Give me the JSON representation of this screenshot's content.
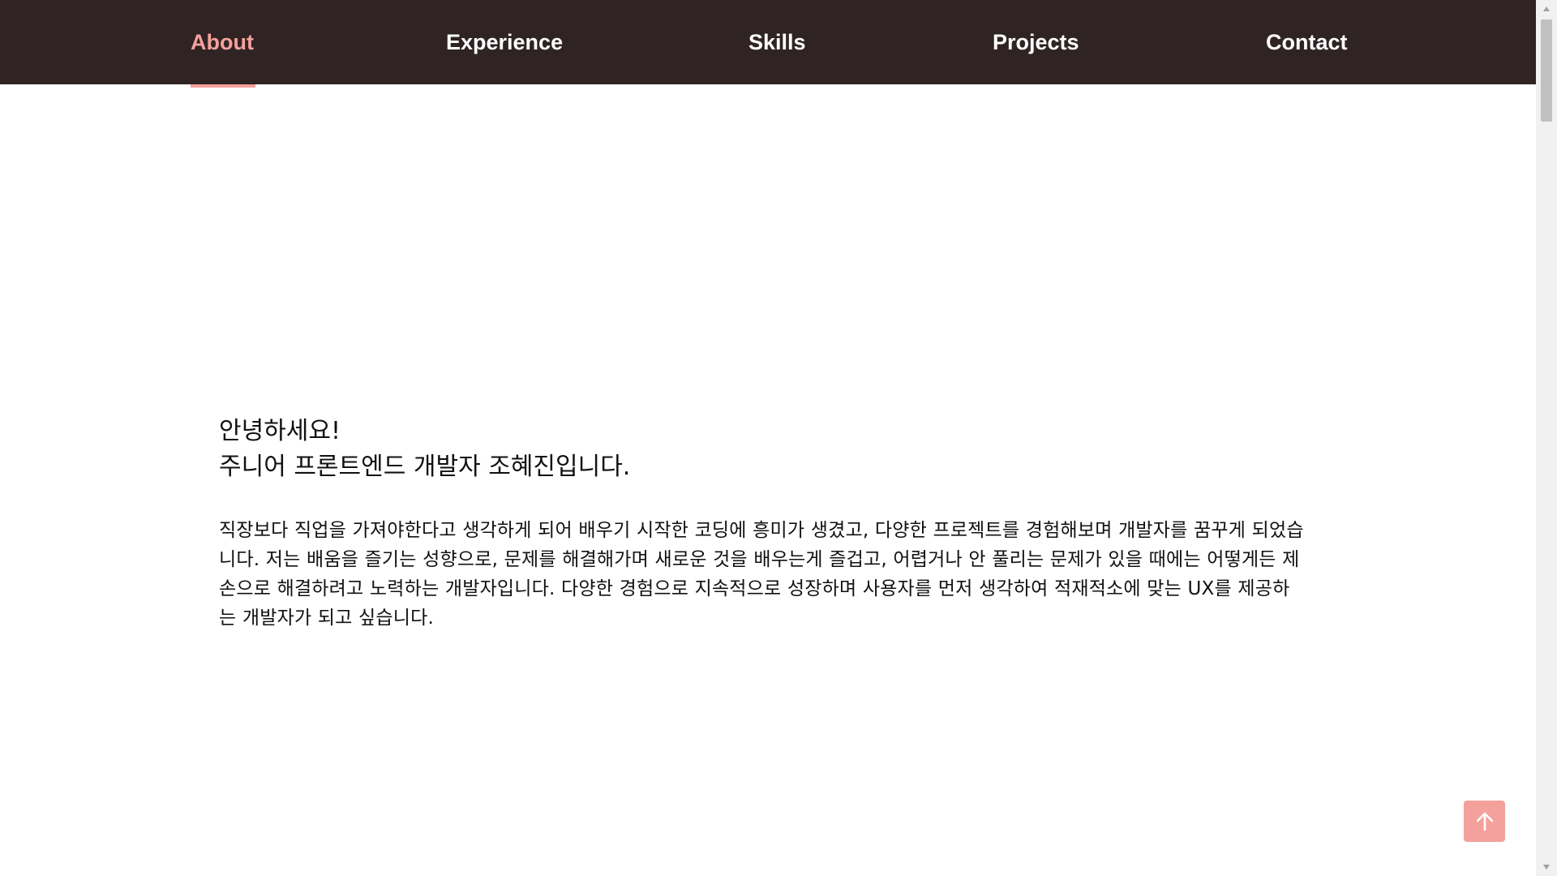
{
  "nav": {
    "items": [
      {
        "label": "About",
        "active": true
      },
      {
        "label": "Experience",
        "active": false
      },
      {
        "label": "Skills",
        "active": false
      },
      {
        "label": "Projects",
        "active": false
      },
      {
        "label": "Contact",
        "active": false
      }
    ]
  },
  "about": {
    "greeting_line1": "안녕하세요!",
    "greeting_line2": "주니어 프론트엔드 개발자 조혜진입니다.",
    "intro": "직장보다 직업을 가져야한다고 생각하게 되어 배우기 시작한 코딩에 흥미가 생겼고, 다양한 프로젝트를 경험해보며 개발자를 꿈꾸게 되었습니다. 저는 배움을 즐기는 성향으로, 문제를 해결해가며 새로운 것을 배우는게 즐겁고, 어렵거나 안 풀리는 문제가 있을 때에는 어떻게든 제 손으로 해결하려고 노력하는 개발자입니다. 다양한 경험으로 지속적으로 성장하며 사용자를 먼저 생각하여 적재적소에 맞는 UX를 제공하는 개발자가 되고 싶습니다."
  },
  "scroll_top": {
    "icon": "arrow-up-icon"
  },
  "colors": {
    "navbar_bg": "#302324",
    "accent": "#f4a19c",
    "nav_text": "#ffffff",
    "body_text": "#111111"
  }
}
